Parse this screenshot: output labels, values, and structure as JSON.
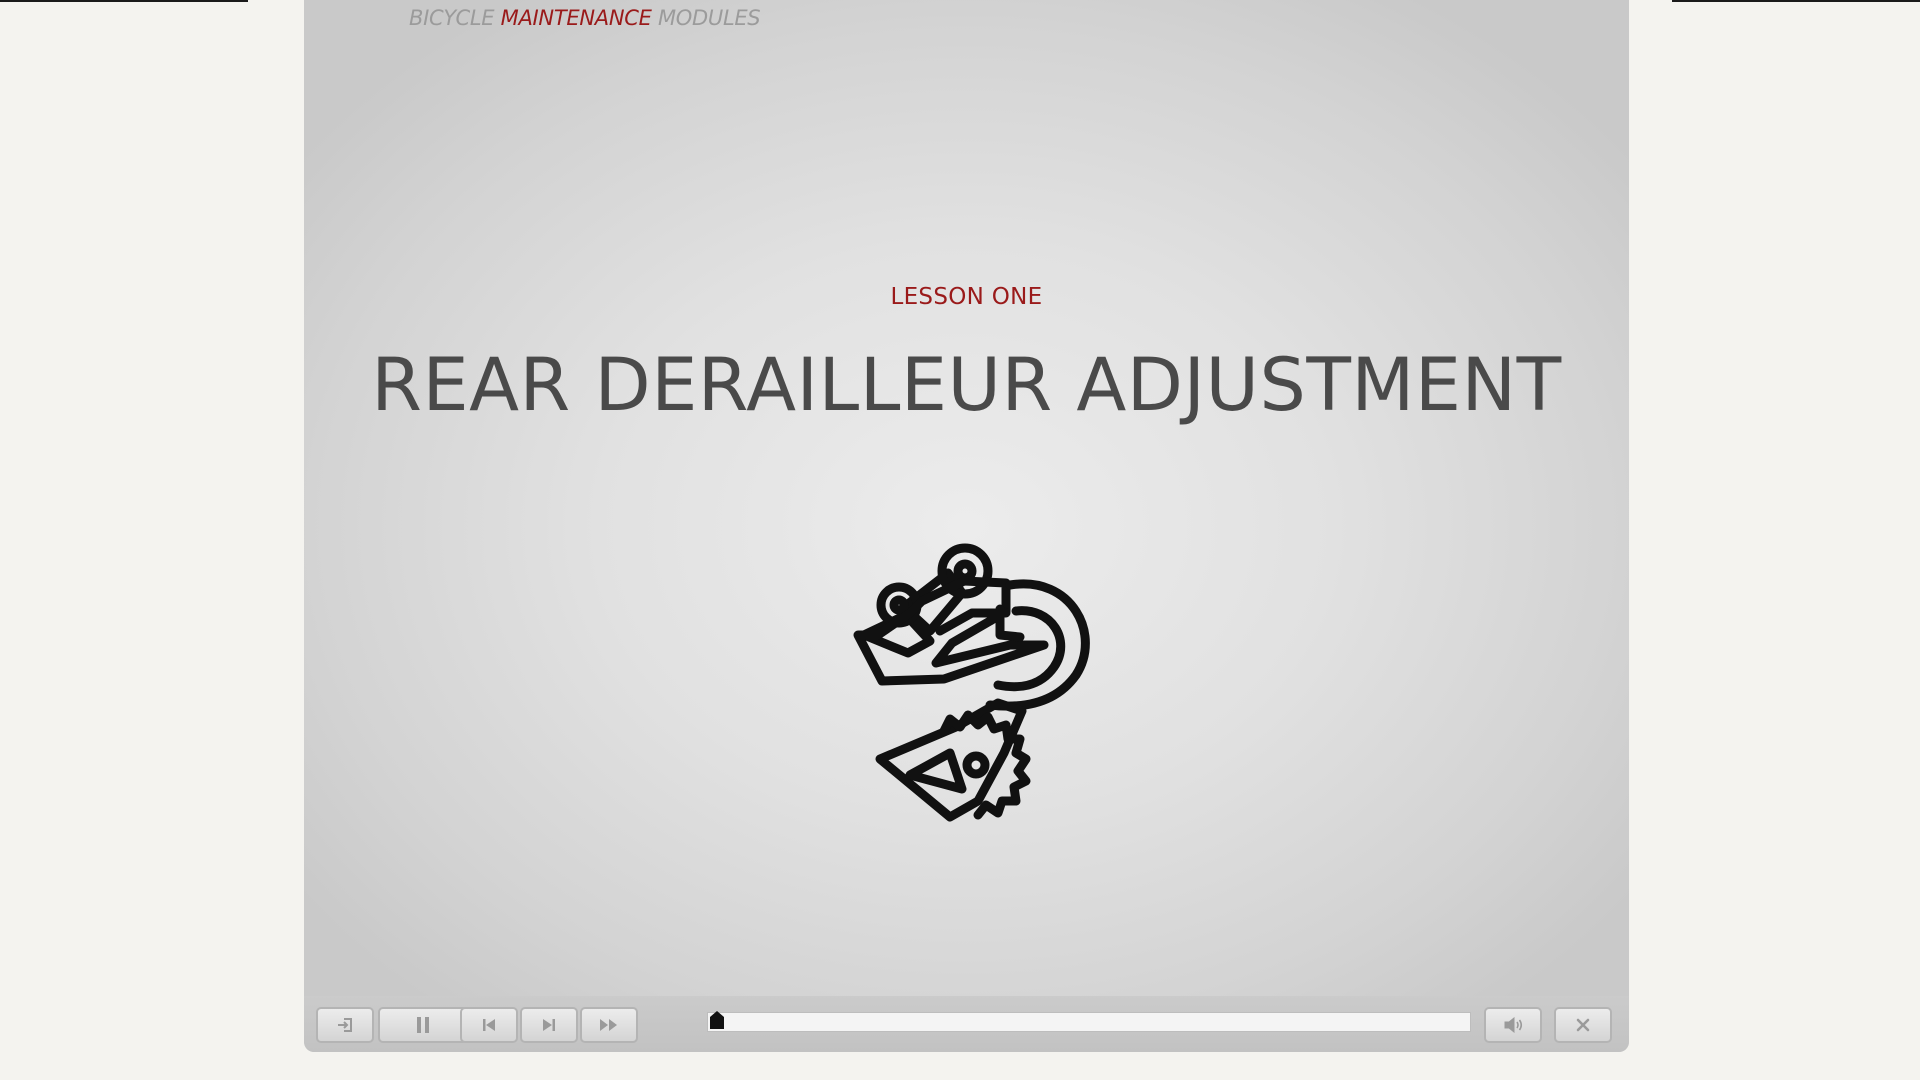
{
  "header": {
    "brand_prefix": "BICYCLE",
    "brand_accent": "MAINTENANCE",
    "brand_suffix": "MODULES"
  },
  "slide": {
    "lesson_label": "LESSON ONE",
    "title": "REAR DERAILLEUR ADJUSTMENT",
    "illustration": "rear-derailleur-icon"
  },
  "player_controls": {
    "buttons": [
      {
        "icon": "exit-icon"
      },
      {
        "icon": "pause-icon"
      },
      {
        "icon": "skip-back-icon"
      },
      {
        "icon": "skip-forward-icon"
      },
      {
        "icon": "fast-forward-icon"
      },
      {
        "icon": "volume-icon"
      },
      {
        "icon": "close-icon"
      }
    ],
    "progress": 0.0
  },
  "colors": {
    "accent": "#9a1a1a",
    "title": "#4a4a4a",
    "brand_gray": "#9b9b9b",
    "page_background": "#f4f3ef"
  }
}
